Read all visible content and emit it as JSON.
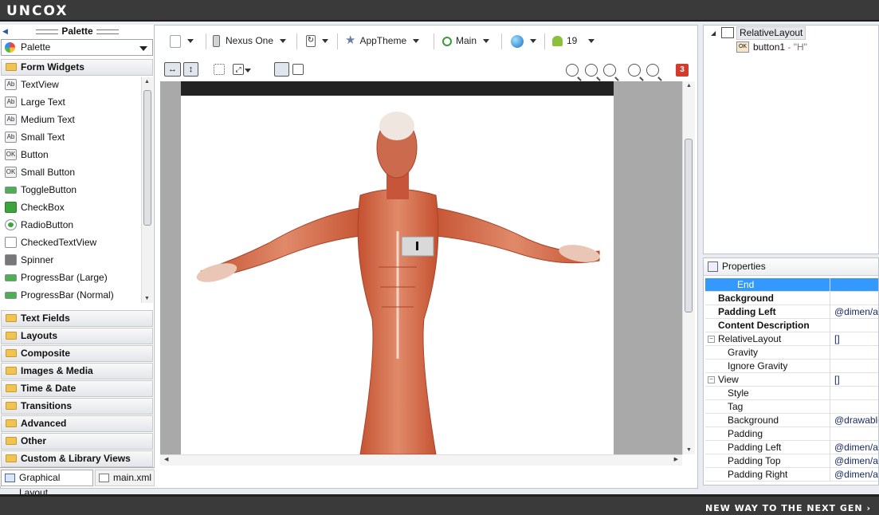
{
  "header": {
    "logo": "UNCOX"
  },
  "footer": {
    "tagline": "NEW WAY TO THE NEXT GEN ›"
  },
  "palette": {
    "title": "Palette",
    "selector": "Palette",
    "sections": {
      "form_widgets": "Form Widgets",
      "text_fields": "Text Fields",
      "layouts": "Layouts",
      "composite": "Composite",
      "images_media": "Images & Media",
      "time_date": "Time & Date",
      "transitions": "Transitions",
      "advanced": "Advanced",
      "other": "Other",
      "custom": "Custom & Library Views"
    },
    "widgets": [
      {
        "label": "TextView",
        "icon": "Ab"
      },
      {
        "label": "Large Text",
        "icon": "Ab"
      },
      {
        "label": "Medium Text",
        "icon": "Ab"
      },
      {
        "label": "Small Text",
        "icon": "Ab"
      },
      {
        "label": "Button",
        "icon": "OK"
      },
      {
        "label": "Small Button",
        "icon": "OK"
      },
      {
        "label": "ToggleButton",
        "icon": "toggle"
      },
      {
        "label": "CheckBox",
        "icon": "check"
      },
      {
        "label": "RadioButton",
        "icon": "radio"
      },
      {
        "label": "CheckedTextView",
        "icon": "checked-text"
      },
      {
        "label": "Spinner",
        "icon": "spinner"
      },
      {
        "label": "ProgressBar (Large)",
        "icon": "progress"
      },
      {
        "label": "ProgressBar (Normal)",
        "icon": "progress"
      }
    ]
  },
  "tabs": {
    "graphical": "Graphical Layout",
    "xml": "main.xml"
  },
  "toolbar": {
    "device": "Nexus One",
    "theme": "AppTheme",
    "activity": "Main",
    "api": "19",
    "error_count": "3"
  },
  "outline": {
    "root": "RelativeLayout",
    "child_name": "button1",
    "child_text": " - \"H\""
  },
  "properties": {
    "title": "Properties",
    "rows": [
      {
        "name": "End",
        "value": "",
        "bold": false,
        "selected": true
      },
      {
        "name": "Background",
        "value": "",
        "bold": true
      },
      {
        "name": "Padding Left",
        "value": "@dimen/activity_horizontal_margin",
        "bold": true
      },
      {
        "name": "Content Description",
        "value": "",
        "bold": true
      },
      {
        "name": "RelativeLayout",
        "value": "[]",
        "bold": false,
        "group": true
      },
      {
        "name": "Gravity",
        "value": "",
        "bold": false
      },
      {
        "name": "Ignore Gravity",
        "value": "",
        "bold": false
      },
      {
        "name": "View",
        "value": "[]",
        "bold": false,
        "group": true
      },
      {
        "name": "Style",
        "value": "",
        "bold": false
      },
      {
        "name": "Tag",
        "value": "",
        "bold": false
      },
      {
        "name": "Background",
        "value": "@drawable/",
        "bold": false
      },
      {
        "name": "Padding",
        "value": "",
        "bold": false
      },
      {
        "name": "Padding Left",
        "value": "@dimen/activity_horizontal_margin",
        "bold": false
      },
      {
        "name": "Padding Top",
        "value": "@dimen/activity_vertical_margin",
        "bold": false
      },
      {
        "name": "Padding Right",
        "value": "@dimen/activity_horizontal_margin",
        "bold": false
      }
    ]
  },
  "colors": {
    "selection": "#3399ff",
    "folder": "#f0c453",
    "error": "#d23c2c"
  }
}
